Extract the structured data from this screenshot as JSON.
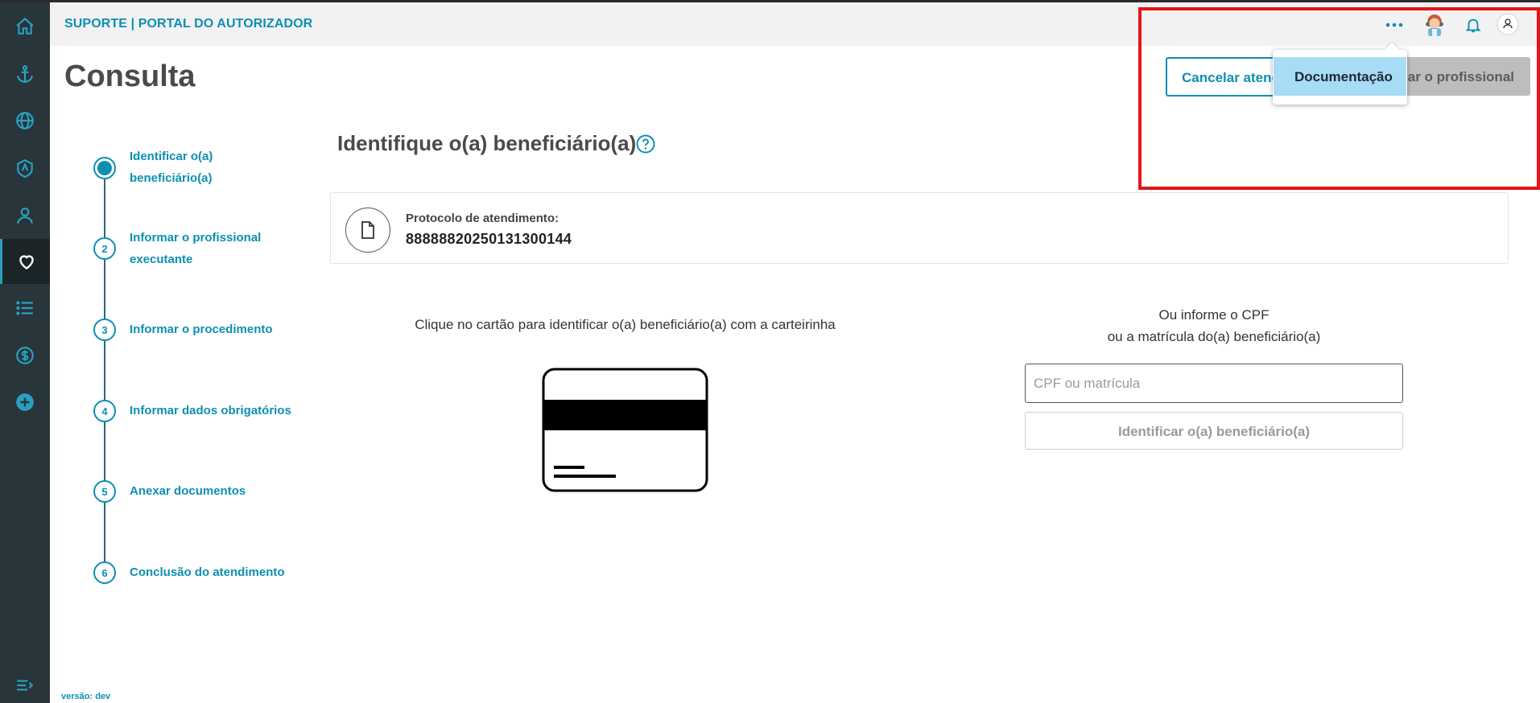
{
  "app_title": "SUPORTE | PORTAL DO AUTORIZADOR",
  "page_title": "Consulta",
  "header": {
    "cancel_label": "Cancelar atendimento",
    "next_label": "Informar o profissional",
    "menu_item": "Documentação"
  },
  "stepper": [
    {
      "number": "",
      "label": "Identificar o(a) beneficiário(a)"
    },
    {
      "number": "2",
      "label": "Informar o profissional executante"
    },
    {
      "number": "3",
      "label": "Informar o procedimento"
    },
    {
      "number": "4",
      "label": "Informar dados obrigatórios"
    },
    {
      "number": "5",
      "label": "Anexar documentos"
    },
    {
      "number": "6",
      "label": "Conclusão do atendimento"
    }
  ],
  "section_title": "Identifique o(a) beneficiário(a)",
  "protocol": {
    "label": "Protocolo de atendimento:",
    "value": "88888820250131300144"
  },
  "card_instruction": "Clique no cartão para identificar o(a) beneficiário(a) com a carteirinha",
  "cpf": {
    "line1": "Ou informe o CPF",
    "line2": "ou a matrícula do(a) beneficiário(a)",
    "placeholder": "CPF ou matrícula",
    "button_label": "Identificar o(a) beneficiário(a)"
  },
  "version": "versão: dev",
  "colors": {
    "accent": "#0c8fb3",
    "sidebar": "#28353a",
    "highlight": "#e5141b"
  }
}
